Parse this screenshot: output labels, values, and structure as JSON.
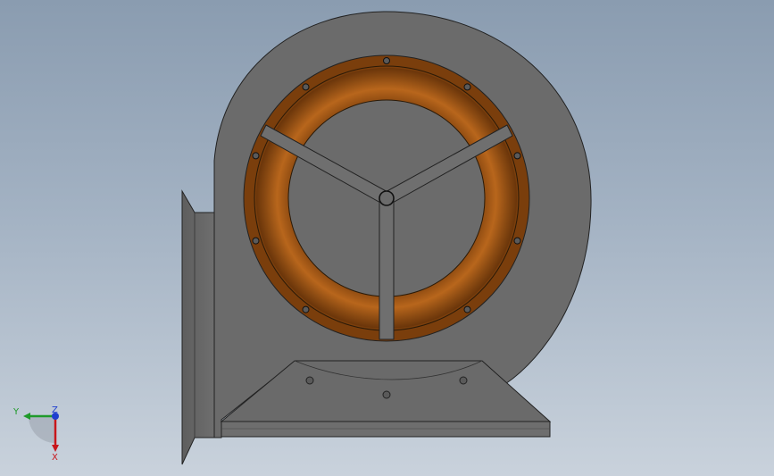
{
  "viewport": {
    "background_top": "#8a9cb0",
    "background_bottom": "#c9d2dc"
  },
  "model": {
    "name": "centrifugal-fan-housing",
    "colors": {
      "housing": "#6b6b6b",
      "outline": "#222222",
      "inlet_ring": "#8a4a12",
      "inlet_ring_highlight": "#c8741f",
      "bolt_hole": "#5a5a5a"
    }
  },
  "triad": {
    "y_label": "Y",
    "z_label": "Z",
    "x_label": "X",
    "colors": {
      "y": "#1f9a2a",
      "z": "#1f3fcf",
      "x": "#c8161b"
    }
  }
}
